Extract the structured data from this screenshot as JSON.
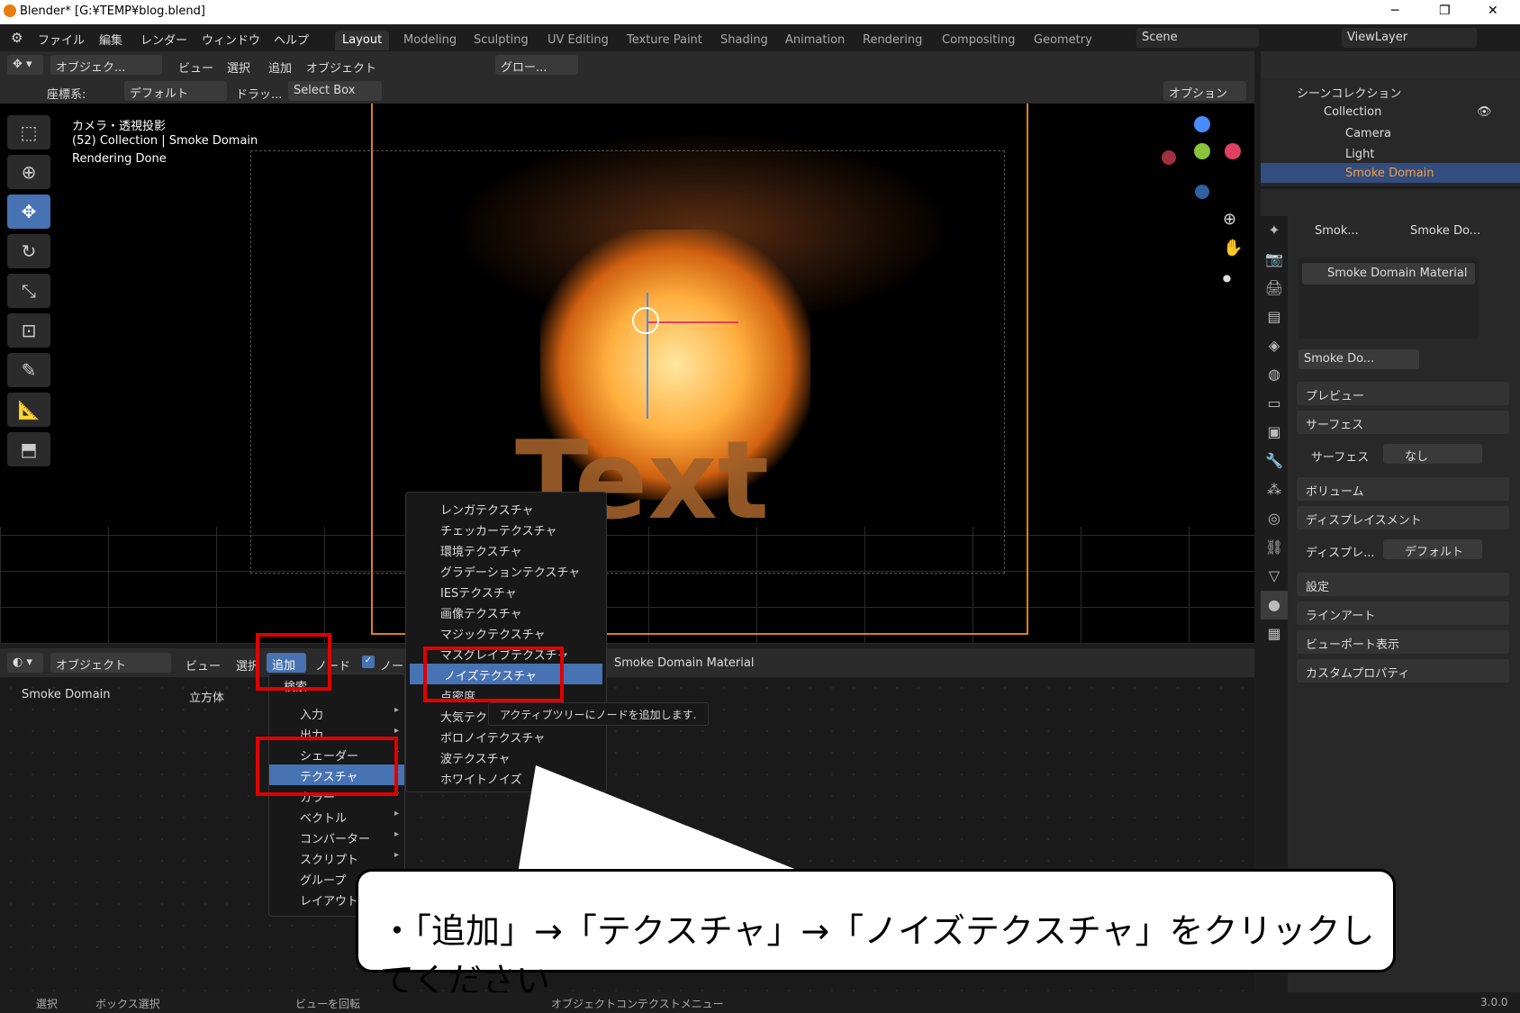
{
  "window": {
    "title": "Blender* [G:¥TEMP¥blog.blend]",
    "minimize": "─",
    "maximize": "❐",
    "close": "✕"
  },
  "menu": [
    "ファイル",
    "編集",
    "レンダー",
    "ウィンドウ",
    "ヘルプ"
  ],
  "workspaces": [
    "Layout",
    "Modeling",
    "Sculpting",
    "UV Editing",
    "Texture Paint",
    "Shading",
    "Animation",
    "Rendering",
    "Compositing",
    "Geometry"
  ],
  "scene": {
    "name": "Scene",
    "view_layer": "ViewLayer"
  },
  "viewport_header": {
    "mode": "オブジェク...",
    "view": "ビュー",
    "select": "選択",
    "add": "追加",
    "object": "オブジェクト",
    "transform": "グロー..."
  },
  "tool_header": {
    "coord_label": "座標系:",
    "coord_value": "デフォルト",
    "drag": "ドラッ...",
    "select_box": "Select Box",
    "options": "オプション"
  },
  "overlay": {
    "line1": "カメラ・透視投影",
    "line2": "(52) Collection | Smoke Domain",
    "line3": "Rendering Done"
  },
  "scene_text": "Text",
  "node_header": {
    "mode": "オブジェクト",
    "view": "ビュー",
    "select": "選択",
    "add": "追加",
    "node": "ノード",
    "checkbox_label": "ノー",
    "material": "Smoke Domain Material"
  },
  "breadcrumb": {
    "object": "Smoke Domain",
    "mesh": "立方体"
  },
  "add_menu": {
    "search": "検索...",
    "items": [
      "入力",
      "出力",
      "シェーダー",
      "テクスチャ",
      "カラー",
      "ベクトル",
      "コンバーター",
      "スクリプト",
      "グループ",
      "レイアウト"
    ]
  },
  "texture_menu": {
    "items": [
      "レンガテクスチャ",
      "チェッカーテクスチャ",
      "環境テクスチャ",
      "グラデーションテクスチャ",
      "IESテクスチャ",
      "画像テクスチャ",
      "マジックテクスチャ",
      "マスグレイブテクスチャ",
      "ノイズテクスチャ",
      "点密度",
      "大気テクスチャ",
      "ボロノイテクスチャ",
      "波テクスチャ",
      "ホワイトノイズ"
    ],
    "tooltip": "アクティブツリーにノードを追加します."
  },
  "outliner": {
    "root": "シーンコレクション",
    "collection": "Collection",
    "items": [
      "Camera",
      "Light",
      "Smoke Domain"
    ]
  },
  "properties": {
    "breadcrumb_obj": "Smok...",
    "breadcrumb_mat": "Smoke Do...",
    "material_slot": "Smoke Domain Material",
    "material_name": "Smoke Do...",
    "panels": {
      "preview": "プレビュー",
      "surface": "サーフェス",
      "surface_label": "サーフェス",
      "surface_value": "なし",
      "volume": "ボリューム",
      "displacement": "ディスプレイスメント",
      "disp_label": "ディスプレ...",
      "disp_value": "デフォルト",
      "settings": "設定",
      "lineart": "ラインアート",
      "viewport_display": "ビューポート表示",
      "custom_props": "カスタムプロパティ"
    }
  },
  "status": {
    "select": "選択",
    "box_select": "ボックス選択",
    "rotate": "ビューを回転",
    "context": "オブジェクトコンテクストメニュー",
    "version": "3.0.0"
  },
  "callout": "・「追加」→「テクスチャ」→「ノイズテクスチャ」をクリックしてください",
  "colors": {
    "accent": "#4772b3",
    "highlight_box": "#e00000",
    "camera_frame": "#e0801c"
  }
}
